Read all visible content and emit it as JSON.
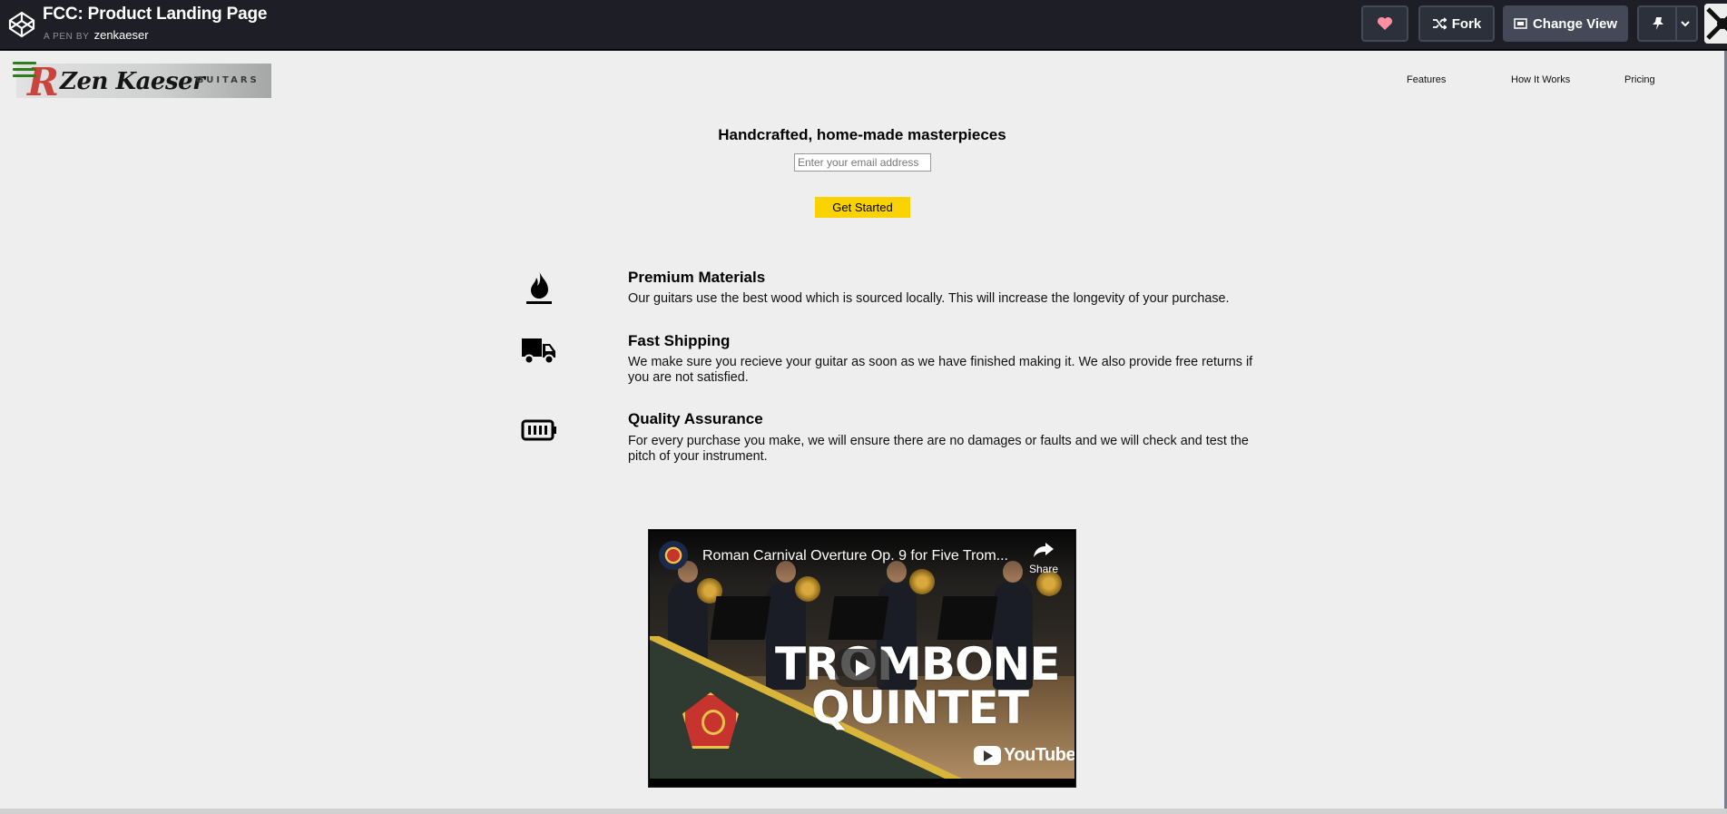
{
  "topbar": {
    "pen_title": "FCC: Product Landing Page",
    "pen_by_label": "A PEN BY",
    "author": "zenkaeser",
    "buttons": {
      "love_icon": "heart-icon",
      "fork_label": "Fork",
      "change_view_label": "Change View",
      "pin_icon": "pin-icon"
    }
  },
  "page": {
    "logo": {
      "letter": "R",
      "name": "Zen Kaeser",
      "tagline": "GUITARS"
    },
    "nav": {
      "features": "Features",
      "how_it_works": "How It Works",
      "pricing": "Pricing"
    },
    "hero": {
      "title": "Handcrafted, home-made masterpieces",
      "email_placeholder": "Enter your email address",
      "cta_label": "Get Started"
    },
    "features": [
      {
        "icon": "fire-icon",
        "title": "Premium Materials",
        "text": "Our guitars use the best wood which is sourced locally. This will increase the longevity of your purchase."
      },
      {
        "icon": "truck-icon",
        "title": "Fast Shipping",
        "text": "We make sure you recieve your guitar as soon as we have finished making it. We also provide free returns if you are not satisfied."
      },
      {
        "icon": "battery-icon",
        "title": "Quality Assurance",
        "text": "For every purchase you make, we will ensure there are no damages or faults and we will check and test the pitch of your instrument."
      }
    ],
    "video": {
      "title": "Roman Carnival Overture Op. 9 for Five Trom...",
      "share_label": "Share",
      "overlay_line1": "TROMBONE",
      "overlay_line2": "QUINTET",
      "brand": "YouTube"
    }
  },
  "colors": {
    "topbar_bg": "#1e1f26",
    "page_bg": "#eeeeee",
    "cta_yellow": "#f9d200",
    "hamburger_green": "#2e7d1e",
    "logo_red": "#c9453b"
  }
}
